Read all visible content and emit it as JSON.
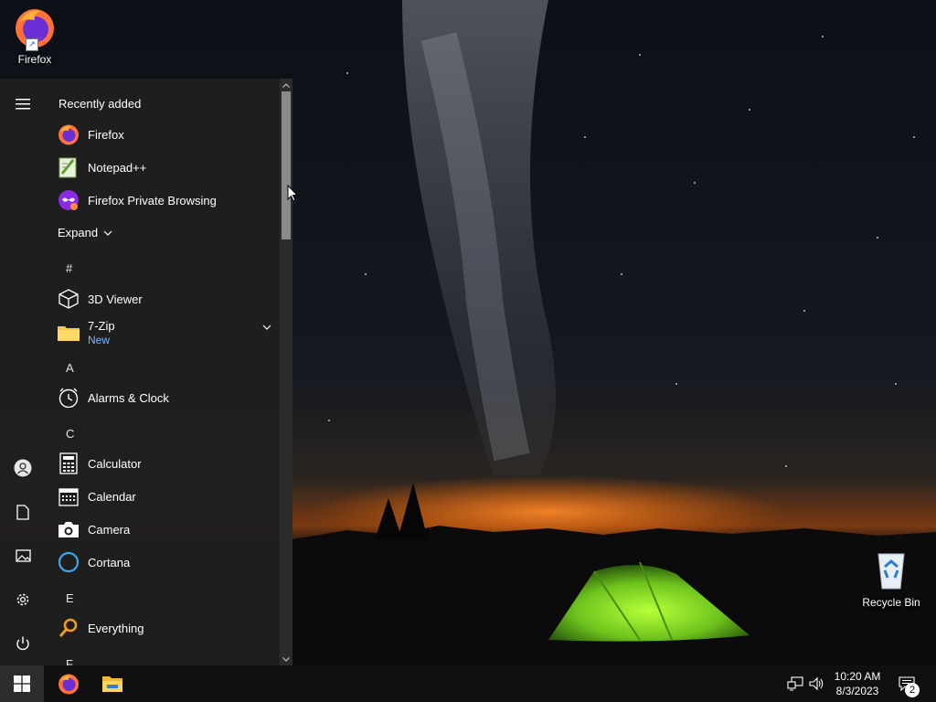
{
  "desktop": {
    "icons": [
      {
        "label": "Firefox",
        "icon": "firefox-icon"
      },
      {
        "label": "Recycle Bin",
        "icon": "recycle-bin-icon"
      }
    ]
  },
  "start_menu": {
    "recently_added_title": "Recently added",
    "recent": [
      {
        "label": "Firefox",
        "icon": "firefox-icon"
      },
      {
        "label": "Notepad++",
        "icon": "notepadpp-icon"
      },
      {
        "label": "Firefox Private Browsing",
        "icon": "firefox-private-icon"
      }
    ],
    "expand_label": "Expand",
    "letters": [
      "#",
      "A",
      "C",
      "E",
      "F"
    ],
    "apps": [
      {
        "label": "3D Viewer",
        "icon": "cube-icon"
      },
      {
        "label": "7-Zip",
        "sublabel": "New",
        "icon": "folder-icon"
      },
      {
        "label": "Alarms & Clock",
        "icon": "alarm-clock-icon"
      },
      {
        "label": "Calculator",
        "icon": "calculator-icon"
      },
      {
        "label": "Calendar",
        "icon": "calendar-icon"
      },
      {
        "label": "Camera",
        "icon": "camera-icon"
      },
      {
        "label": "Cortana",
        "icon": "cortana-icon"
      },
      {
        "label": "Everything",
        "icon": "magnifier-icon"
      }
    ],
    "rail": [
      "hamburger-menu-icon",
      "user-icon",
      "document-icon",
      "pictures-icon",
      "settings-icon",
      "power-icon"
    ]
  },
  "taskbar": {
    "pinned": [
      "firefox-icon",
      "file-explorer-icon"
    ],
    "clock_time": "10:20 AM",
    "clock_date": "8/3/2023",
    "notification_count": "2",
    "tray": [
      "network-icon",
      "volume-icon",
      "action-center-icon"
    ]
  },
  "colors": {
    "accent_link": "#7fb6ff",
    "menu_bg": "#1f1f1f",
    "taskbar_bg": "#101010"
  }
}
